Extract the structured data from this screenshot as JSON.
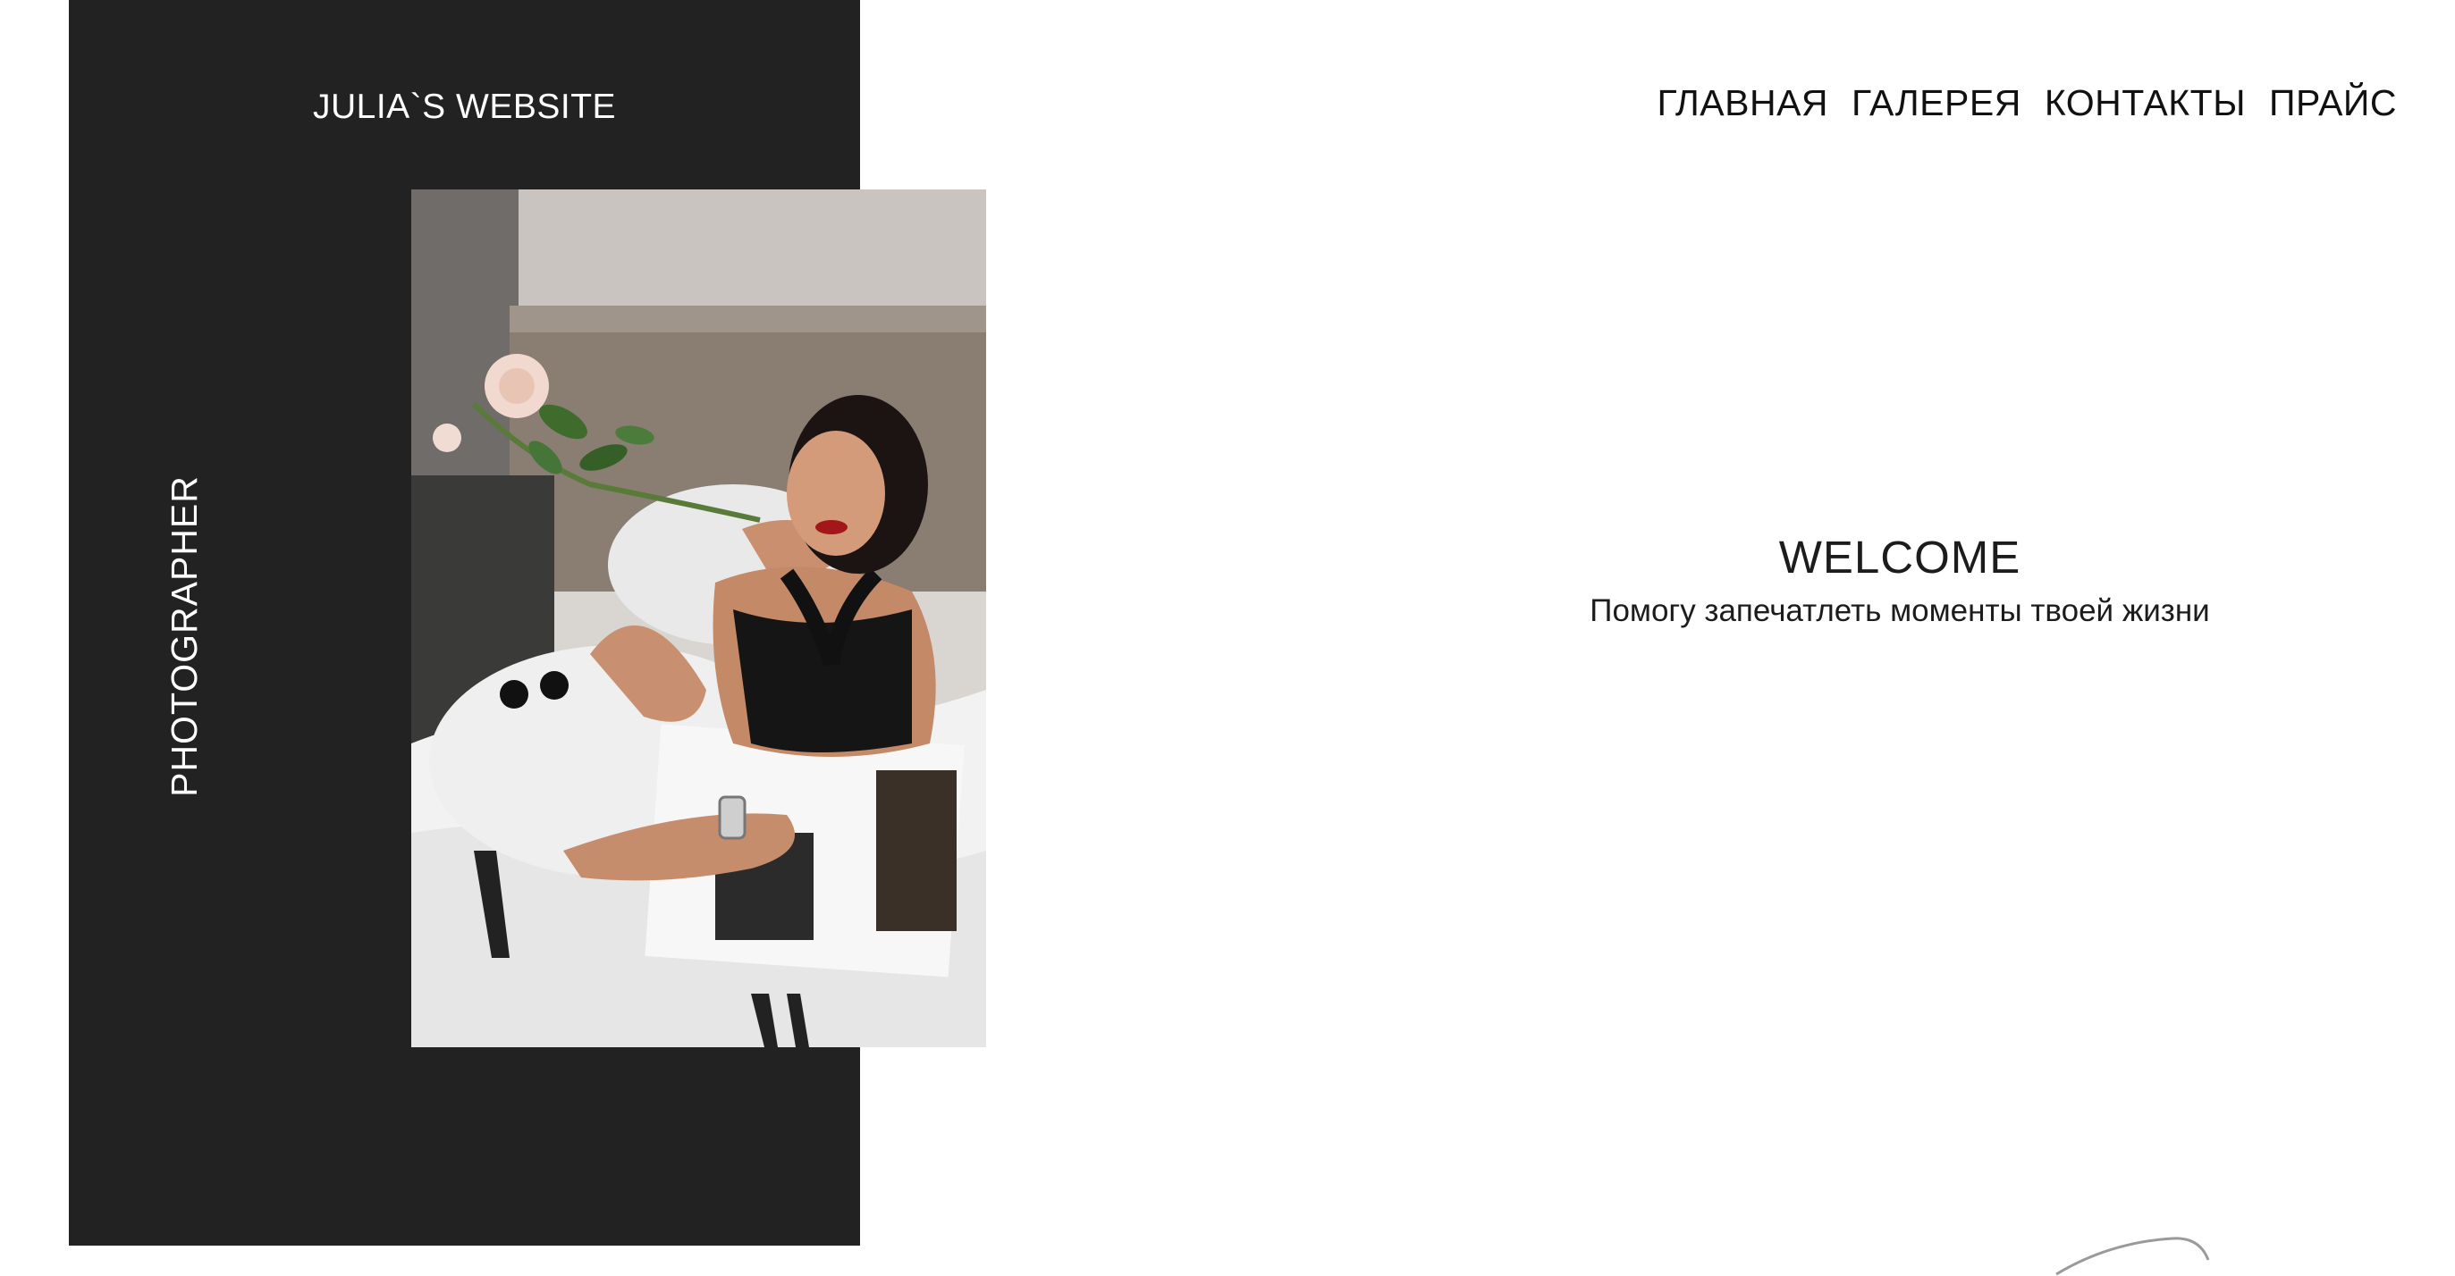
{
  "header": {
    "site_title": "JULIA`S WEBSITE",
    "side_label": "PHOTOGRAPHER"
  },
  "nav": {
    "items": [
      {
        "label": "ГЛАВНАЯ"
      },
      {
        "label": "ГАЛЕРЕЯ"
      },
      {
        "label": "КОНТАКТЫ"
      },
      {
        "label": "ПРАЙС"
      }
    ]
  },
  "hero": {
    "title": "WELCOME",
    "subtitle": "Помогу запечатлеть моменты твоей жизни"
  },
  "colors": {
    "panel": "#222222",
    "background": "#ffffff",
    "text_dark": "#111111"
  }
}
